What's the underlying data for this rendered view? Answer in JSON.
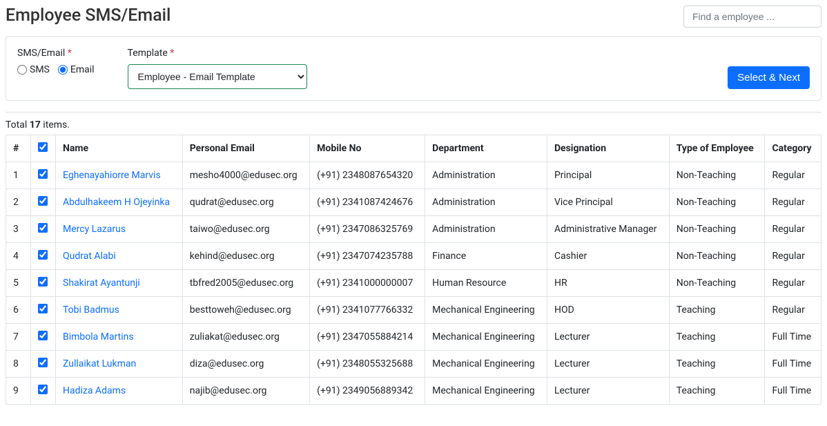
{
  "page": {
    "title": "Employee SMS/Email",
    "search_placeholder": "Find a employee ..."
  },
  "filters": {
    "sms_email_label": "SMS/Email",
    "sms_label": "SMS",
    "email_label": "Email",
    "template_label": "Template",
    "template_selected": "Employee - Email Template",
    "required_marker": "*"
  },
  "actions": {
    "select_next": "Select & Next"
  },
  "summary": {
    "prefix": "Total ",
    "count": "17",
    "suffix": " items."
  },
  "table": {
    "headers": {
      "num": "#",
      "name": "Name",
      "email": "Personal Email",
      "mobile": "Mobile No",
      "department": "Department",
      "designation": "Designation",
      "type": "Type of Employee",
      "category": "Category"
    },
    "rows": [
      {
        "num": "1",
        "name": "Eghenayahiorre Marvis",
        "email": "mesho4000@edusec.org",
        "mobile": "(+91) 2348087654320",
        "department": "Administration",
        "designation": "Principal",
        "type": "Non-Teaching",
        "category": "Regular"
      },
      {
        "num": "2",
        "name": "Abdulhakeem H Ojeyinka",
        "email": "qudrat@edusec.org",
        "mobile": "(+91) 2341087424676",
        "department": "Administration",
        "designation": "Vice Principal",
        "type": "Non-Teaching",
        "category": "Regular"
      },
      {
        "num": "3",
        "name": "Mercy Lazarus",
        "email": "taiwo@edusec.org",
        "mobile": "(+91) 2347086325769",
        "department": "Administration",
        "designation": "Administrative Manager",
        "type": "Non-Teaching",
        "category": "Regular"
      },
      {
        "num": "4",
        "name": "Qudrat Alabi",
        "email": "kehind@edusec.org",
        "mobile": "(+91) 2347074235788",
        "department": "Finance",
        "designation": "Cashier",
        "type": "Non-Teaching",
        "category": "Regular"
      },
      {
        "num": "5",
        "name": "Shakirat Ayantunji",
        "email": "tbfred2005@edusec.org",
        "mobile": "(+91) 2341000000007",
        "department": "Human Resource",
        "designation": "HR",
        "type": "Non-Teaching",
        "category": "Regular"
      },
      {
        "num": "6",
        "name": "Tobi Badmus",
        "email": "besttoweh@edusec.org",
        "mobile": "(+91) 2341077766332",
        "department": "Mechanical Engineering",
        "designation": "HOD",
        "type": "Teaching",
        "category": "Regular"
      },
      {
        "num": "7",
        "name": "Bimbola Martins",
        "email": "zuliakat@edusec.org",
        "mobile": "(+91) 2347055884214",
        "department": "Mechanical Engineering",
        "designation": "Lecturer",
        "type": "Teaching",
        "category": "Full Time"
      },
      {
        "num": "8",
        "name": "Zullaikat Lukman",
        "email": "diza@edusec.org",
        "mobile": "(+91) 2348055325688",
        "department": "Mechanical Engineering",
        "designation": "Lecturer",
        "type": "Teaching",
        "category": "Full Time"
      },
      {
        "num": "9",
        "name": "Hadiza Adams",
        "email": "najib@edusec.org",
        "mobile": "(+91) 2349056889342",
        "department": "Mechanical Engineering",
        "designation": "Lecturer",
        "type": "Teaching",
        "category": "Full Time"
      }
    ]
  }
}
